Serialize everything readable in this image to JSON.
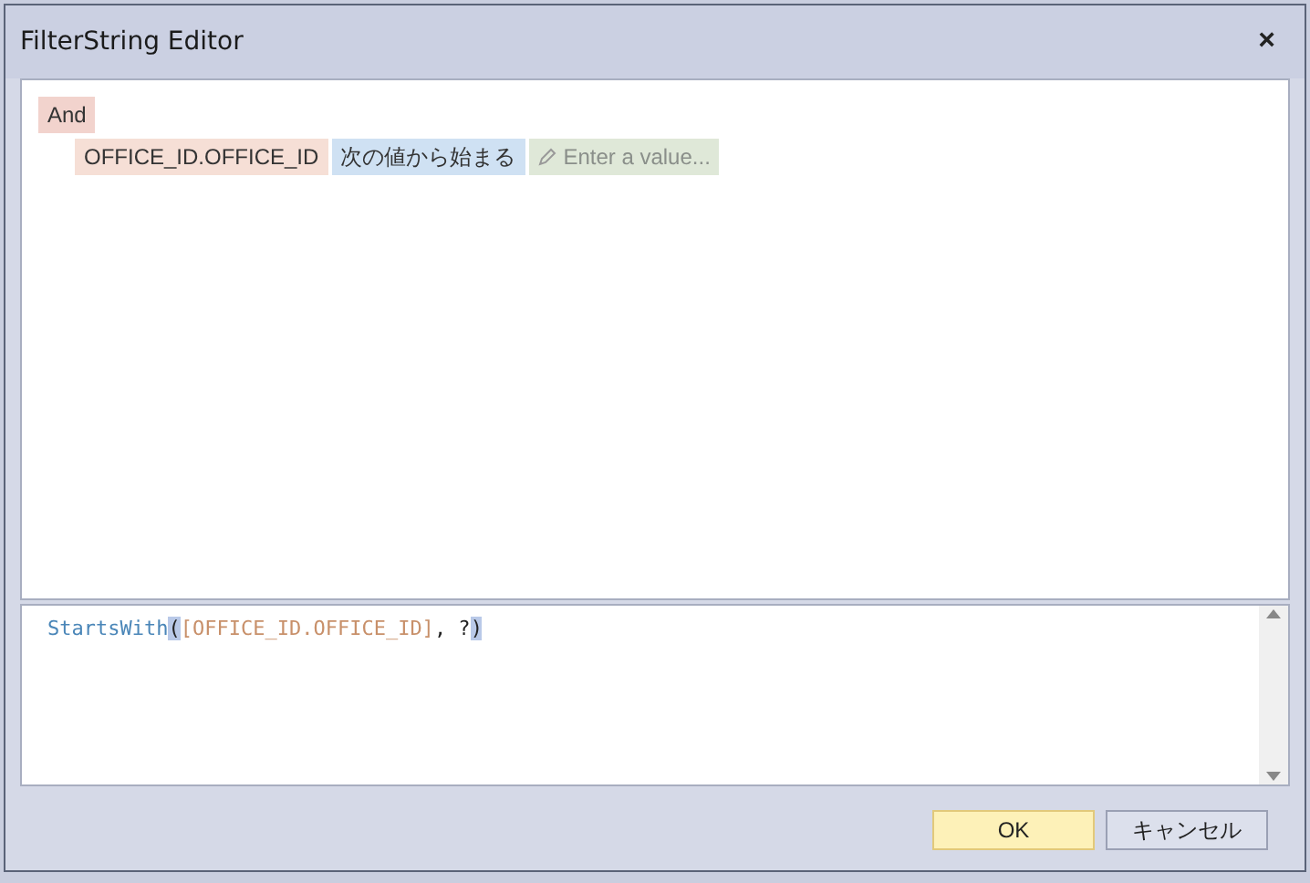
{
  "window": {
    "title": "FilterString Editor",
    "close": "×"
  },
  "filter_tree": {
    "group": {
      "operator": "And",
      "children": [
        {
          "field": "OFFICE_ID.OFFICE_ID",
          "operation": "次の値から始まる",
          "value_placeholder": "Enter a value..."
        }
      ]
    }
  },
  "expression": {
    "tokens": [
      {
        "text": "StartsWith",
        "kind": "function",
        "highlighted": false
      },
      {
        "text": "(",
        "kind": "plain",
        "highlighted": true
      },
      {
        "text": "[OFFICE_ID.OFFICE_ID]",
        "kind": "field",
        "highlighted": false
      },
      {
        "text": ", ?",
        "kind": "plain",
        "highlighted": false
      },
      {
        "text": ")",
        "kind": "plain",
        "highlighted": true
      }
    ]
  },
  "buttons": [
    {
      "label": "OK",
      "focused": true
    },
    {
      "label": "キャンセル",
      "focused": false
    }
  ]
}
